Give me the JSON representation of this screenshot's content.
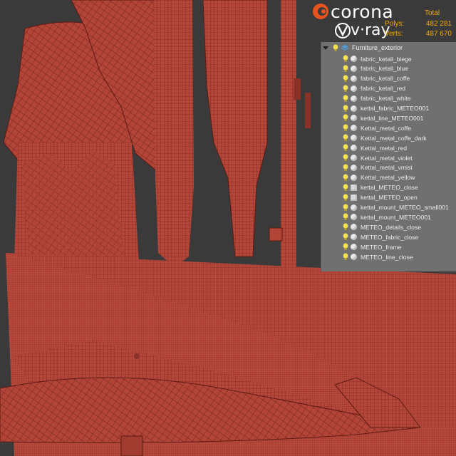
{
  "brands": {
    "corona": "corona",
    "vray": "v·ray"
  },
  "stats": {
    "total_label": "Total",
    "polys_label": "Polys:",
    "polys_value": "482 281",
    "verts_label": "Verts:",
    "verts_value": "487 670"
  },
  "outliner": {
    "root_label": "Furniture_exterior",
    "items": [
      {
        "label": "fabric_ketall_biege",
        "type": "object"
      },
      {
        "label": "fabric_ketall_blue",
        "type": "object"
      },
      {
        "label": "fabric_ketall_coffe",
        "type": "object"
      },
      {
        "label": "fabric_ketall_red",
        "type": "object"
      },
      {
        "label": "fabric_ketall_white",
        "type": "object"
      },
      {
        "label": "kettal_fabric_METEO001",
        "type": "object"
      },
      {
        "label": "kettal_line_METEO001",
        "type": "object"
      },
      {
        "label": "Kettal_metal_coffe",
        "type": "object"
      },
      {
        "label": "Kettal_metal_coffe_dark",
        "type": "object"
      },
      {
        "label": "Kettal_metal_red",
        "type": "object"
      },
      {
        "label": "Kettal_metal_violet",
        "type": "object"
      },
      {
        "label": "Kettal_metal_vmist",
        "type": "object"
      },
      {
        "label": "Kettal_metal_yellow",
        "type": "object"
      },
      {
        "label": "kettal_METEO_close",
        "type": "group"
      },
      {
        "label": "kettal_METEO_open",
        "type": "group"
      },
      {
        "label": "kettal_mount_METEO_small001",
        "type": "object"
      },
      {
        "label": "kettal_mount_METEO001",
        "type": "object"
      },
      {
        "label": "METEO_details_close",
        "type": "object"
      },
      {
        "label": "METEO_fabric_close",
        "type": "object"
      },
      {
        "label": "METEO_frame",
        "type": "object"
      },
      {
        "label": "METEO_line_close",
        "type": "object"
      }
    ]
  },
  "colors": {
    "mesh": "#b5463a",
    "wire": "#6a1e16",
    "background": "#3a3a3a",
    "stats_text": "#f2a900",
    "outliner_bg": "#707070"
  }
}
